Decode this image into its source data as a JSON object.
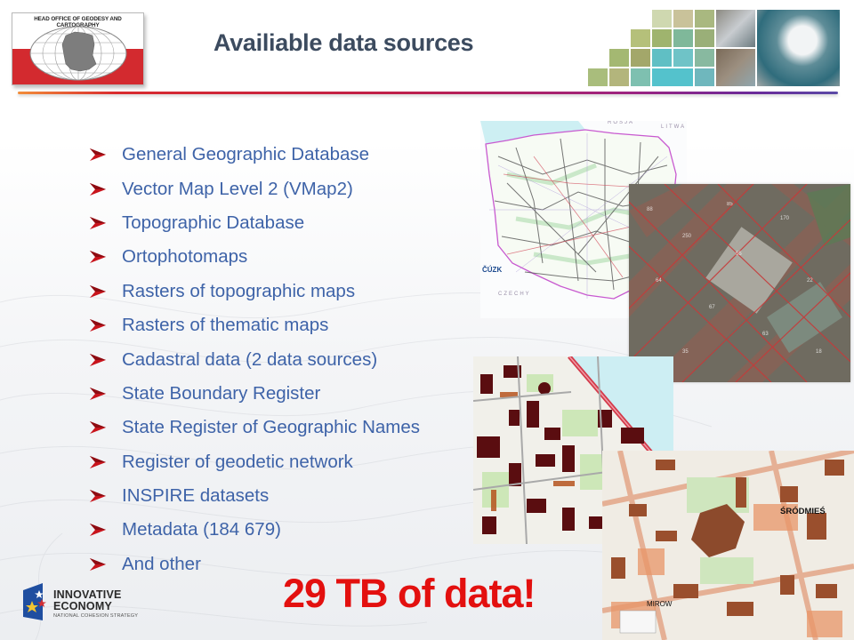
{
  "header": {
    "logo_caption": "HEAD OFFICE OF GEODESY AND CARTOGRAPHY",
    "title": "Availiable data sources"
  },
  "bullets": [
    {
      "label": "General Geographic Database"
    },
    {
      "label": "Vector Map Level 2 (VMap2)"
    },
    {
      "label": "Topographic Database"
    },
    {
      "label": "Ortophotomaps"
    },
    {
      "label": "Rasters of topographic maps"
    },
    {
      "label": "Rasters of thematic maps"
    },
    {
      "label": "Cadastral data (2 data sources)"
    },
    {
      "label": "State Boundary Register"
    },
    {
      "label": "State Register of Geographic Names"
    },
    {
      "label": "Register of geodetic network"
    },
    {
      "label": "INSPIRE datasets"
    },
    {
      "label": "Metadata (184 679)"
    },
    {
      "label": "And other"
    }
  ],
  "maps": {
    "poland": {
      "label_north": "ROSJA",
      "label_east": "LITWA",
      "label_south": "CZECHY",
      "logo": "ČÚZK"
    },
    "city_topo": {
      "district": "ŚRÓDMIEŚ",
      "area": "MIROW"
    }
  },
  "footer": {
    "logo_line1": "INNOVATIVE",
    "logo_line2": "ECONOMY",
    "logo_line3": "NATIONAL COHESION STRATEGY",
    "stat": "29 TB of data!"
  },
  "colors": {
    "title": "#3c4b5f",
    "bullet_text": "#3e63a8",
    "bullet_arrow": "#c8141c",
    "stat": "#e3100f"
  }
}
